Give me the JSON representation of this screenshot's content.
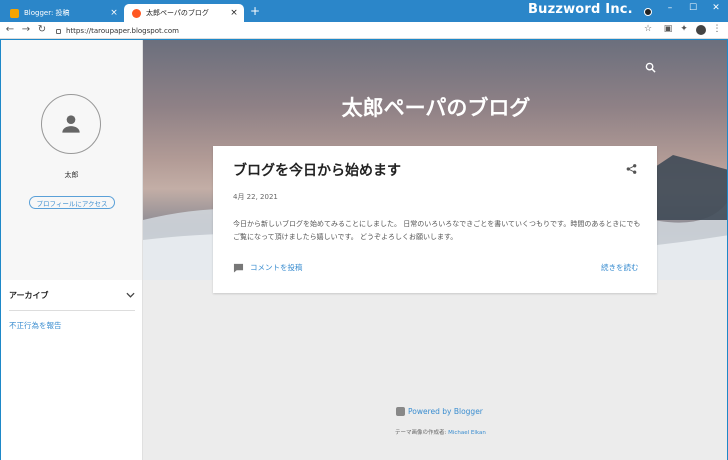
{
  "browser": {
    "tabs": [
      {
        "title": "Blogger: 投稿",
        "close": "×"
      },
      {
        "title": "太郎ペーパのブログ",
        "close": "×"
      }
    ],
    "new_tab": "+",
    "brand": "Buzzword Inc.",
    "window_controls": [
      "–",
      "☐",
      "✕"
    ],
    "url": "https://taroupaper.blogspot.com"
  },
  "sidebar": {
    "owner_name": "太郎",
    "profile_button": "プロフィールにアクセス",
    "archive_label": "アーカイブ",
    "report_link": "不正行為を報告"
  },
  "header": {
    "blog_title": "太郎ペーパのブログ"
  },
  "post": {
    "title": "ブログを今日から始めます",
    "date": "4月 22, 2021",
    "body": "今日から新しいブログを始めてみることにしました。 日常のいろいろなできごとを書いていくつもりです。時間のあるときにでもご覧になって頂けましたら嬉しいです。 どうぞよろしくお願いします。",
    "comment_link": "コメントを投稿",
    "read_more": "続きを読む"
  },
  "footer": {
    "powered": "Powered by Blogger",
    "credit_prefix": "テーマ画像の作成者:",
    "credit_author": "Michael Elkan"
  },
  "colors": {
    "accent": "#3a8dd0",
    "chrome": "#2b86c9"
  }
}
